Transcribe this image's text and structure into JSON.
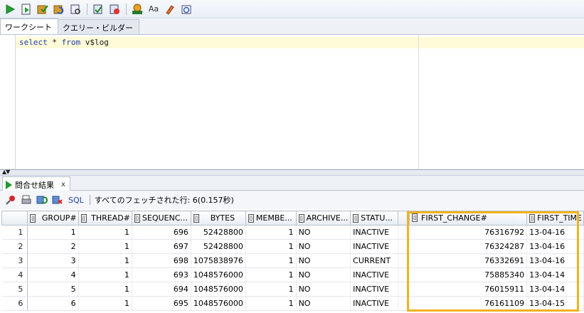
{
  "toolbar": {
    "icons": [
      "run-statement-icon",
      "run-script-icon",
      "commit-icon",
      "rollback-icon",
      "autotrace-icon",
      "explain-plan-icon",
      "cancel-icon",
      "sql-tuning-icon",
      "to-upper-lower-icon",
      "clear-icon",
      "history-icon"
    ]
  },
  "tabs": [
    {
      "label": "ワークシート",
      "active": true
    },
    {
      "label": "クエリー・ビルダー",
      "active": false
    }
  ],
  "editor": {
    "kw_select": "select",
    "rest1": " * ",
    "kw_from": "from",
    "rest2": " v$log"
  },
  "results": {
    "tab_label": "問合せ結果",
    "close_label": "x",
    "sql_label": "SQL",
    "fetch_status": "すべてのフェッチされた行: 6(0.157秒)"
  },
  "table": {
    "columns": [
      "GROUP#",
      "THREAD#",
      "SEQUENC...",
      "BYTES",
      "MEMBE...",
      "ARCHIVE...",
      "STATU...",
      "FIRST_CHANGE#",
      "FIRST_TIME"
    ],
    "rows": [
      {
        "n": "1",
        "cells": [
          "1",
          "1",
          "696",
          "52428800",
          "1",
          "NO",
          "INACTIVE",
          "76316792",
          "13-04-16"
        ]
      },
      {
        "n": "2",
        "cells": [
          "2",
          "1",
          "697",
          "52428800",
          "1",
          "NO",
          "INACTIVE",
          "76324287",
          "13-04-16"
        ]
      },
      {
        "n": "3",
        "cells": [
          "3",
          "1",
          "698",
          "1075838976",
          "1",
          "NO",
          "CURRENT",
          "76332691",
          "13-04-16"
        ]
      },
      {
        "n": "4",
        "cells": [
          "4",
          "1",
          "693",
          "1048576000",
          "1",
          "NO",
          "INACTIVE",
          "75885340",
          "13-04-14"
        ]
      },
      {
        "n": "5",
        "cells": [
          "5",
          "1",
          "694",
          "1048576000",
          "1",
          "NO",
          "INACTIVE",
          "76015911",
          "13-04-14"
        ]
      },
      {
        "n": "6",
        "cells": [
          "6",
          "1",
          "695",
          "1048576000",
          "1",
          "NO",
          "INACTIVE",
          "76161109",
          "13-04-15"
        ]
      }
    ]
  },
  "colors": {
    "highlight": "#f3b21d",
    "keyword": "#1f3ea8",
    "current_line": "#fffbd9"
  }
}
